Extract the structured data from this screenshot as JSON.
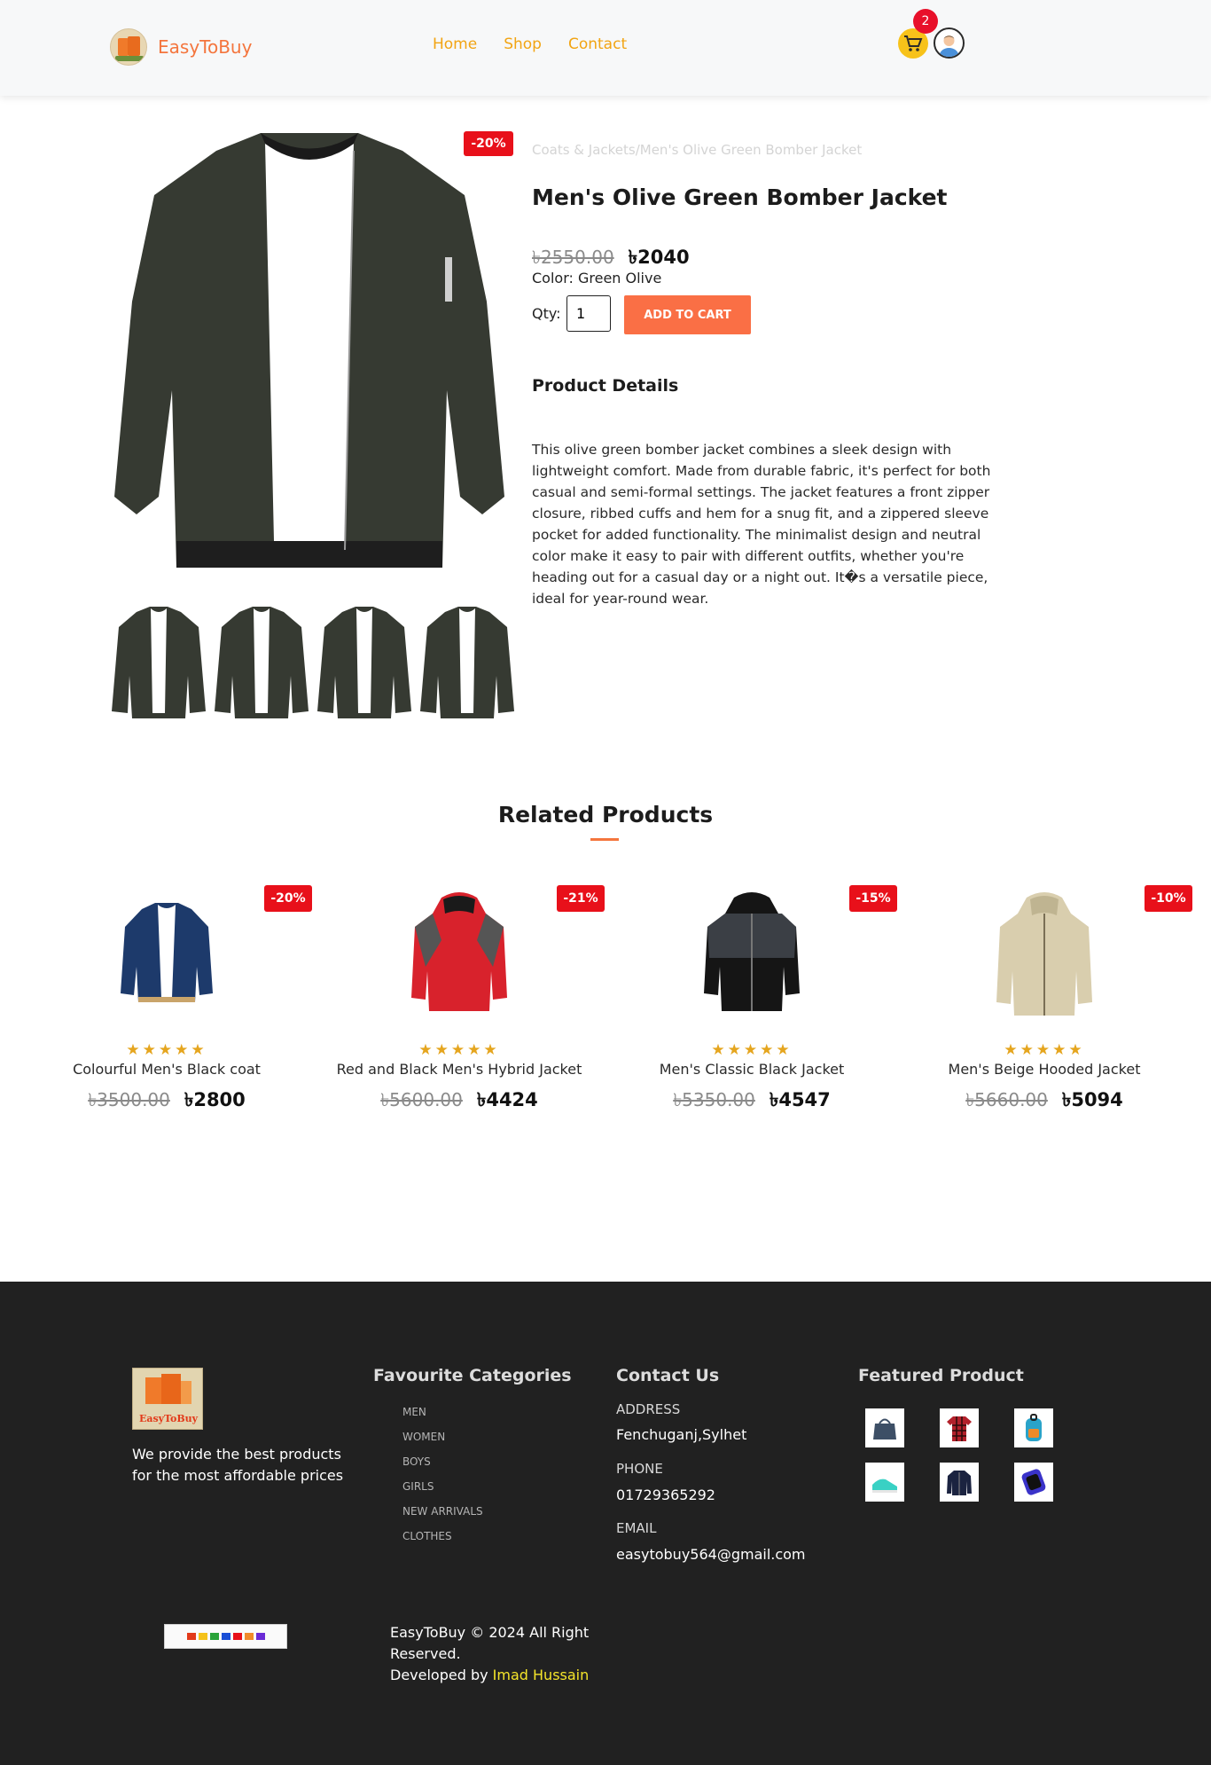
{
  "header": {
    "brand": "EasyToBuy",
    "nav": [
      "Home",
      "Shop",
      "Contact"
    ],
    "cart_count": "2"
  },
  "product": {
    "discount": "-20%",
    "breadcrumb": "Coats & Jackets/Men's Olive Green Bomber Jacket",
    "title": "Men's Olive Green Bomber Jacket",
    "old_price": "৳2550.00",
    "new_price": "৳2040",
    "color_line": "Color: Green Olive",
    "qty_label": "Qty:",
    "qty_value": "1",
    "add_to_cart": "ADD TO CART",
    "details_heading": "Product Details",
    "description": "This olive green bomber jacket combines a sleek design with lightweight comfort. Made from durable fabric, it's perfect for both casual and semi-formal settings. The jacket features a front zipper closure, ribbed cuffs and hem for a snug fit, and a zippered sleeve pocket for added functionality. The minimalist design and neutral color make it easy to pair with different outfits, whether you're heading out for a casual day or a night out. It�s a versatile piece, ideal for year-round wear."
  },
  "related": {
    "heading": "Related Products",
    "stars": "★★★★★",
    "items": [
      {
        "name": "Colourful Men's Black coat",
        "old_price": "৳3500.00",
        "new_price": "৳2800",
        "discount": "-20%",
        "color": "#1d3a6b"
      },
      {
        "name": "Red and Black Men's Hybrid Jacket",
        "old_price": "৳5600.00",
        "new_price": "৳4424",
        "discount": "-21%",
        "color": "#d8222c"
      },
      {
        "name": "Men's Classic Black Jacket",
        "old_price": "৳5350.00",
        "new_price": "৳4547",
        "discount": "-15%",
        "color": "#151515"
      },
      {
        "name": "Men's Beige Hooded Jacket",
        "old_price": "৳5660.00",
        "new_price": "৳5094",
        "discount": "-10%",
        "color": "#d9ceae"
      }
    ]
  },
  "footer": {
    "logo_text": "EasyToBuy",
    "tagline": "We provide the best products for the most affordable prices",
    "categories_heading": "Favourite Categories",
    "categories": [
      "MEN",
      "WOMEN",
      "BOYS",
      "GIRLS",
      "NEW ARRIVALS",
      "CLOTHES"
    ],
    "contact_heading": "Contact Us",
    "address_label": "ADDRESS",
    "address": "Fenchuganj,Sylhet",
    "phone_label": "PHONE",
    "phone": "01729365292",
    "email_label": "EMAIL",
    "email": "easytobuy564@gmail.com",
    "featured_heading": "Featured Product",
    "copyright": "EasyToBuy © 2024 All Right Reserved.",
    "developed_by": "Developed by",
    "developer": "Imad Hussain"
  }
}
